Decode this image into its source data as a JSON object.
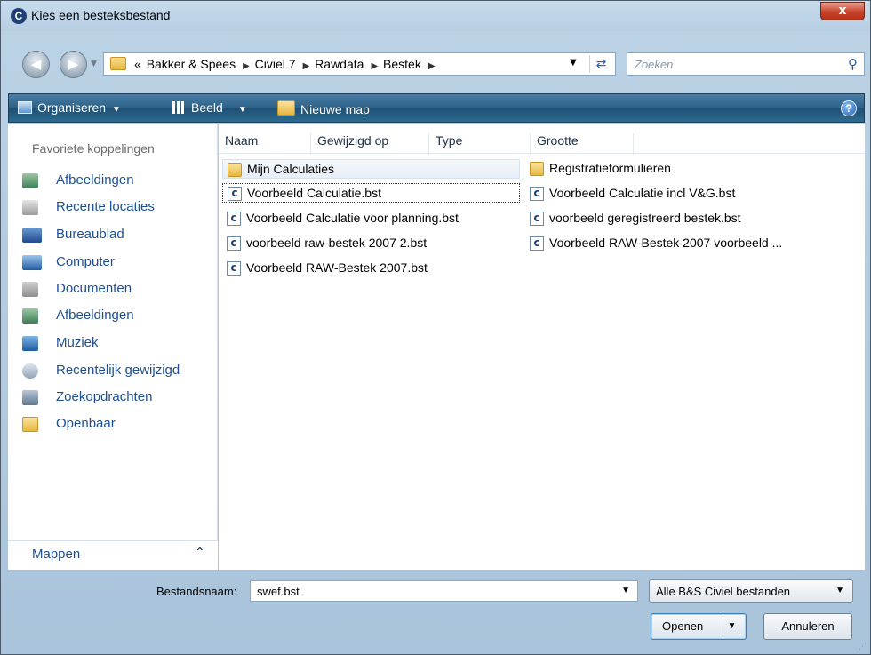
{
  "window": {
    "title": "Kies een besteksbestand",
    "close_label": "x"
  },
  "address_bar": {
    "overflow": "«",
    "crumbs": [
      "Bakker & Spees",
      "Civiel 7",
      "Rawdata",
      "Bestek"
    ]
  },
  "search": {
    "placeholder": "Zoeken"
  },
  "toolbar": {
    "organize_label": "Organiseren",
    "view_label": "Beeld",
    "new_folder_label": "Nieuwe map",
    "help_label": "?"
  },
  "nav_pane": {
    "heading": "Favoriete koppelingen",
    "items": [
      {
        "label": "Afbeeldingen",
        "icon": "pictures-icon"
      },
      {
        "label": "Recente locaties",
        "icon": "recent-places-icon"
      },
      {
        "label": "Bureaublad",
        "icon": "desktop-icon"
      },
      {
        "label": "Computer",
        "icon": "computer-icon"
      },
      {
        "label": "Documenten",
        "icon": "documents-icon"
      },
      {
        "label": "Afbeeldingen",
        "icon": "pictures-icon"
      },
      {
        "label": "Muziek",
        "icon": "music-icon"
      },
      {
        "label": "Recentelijk gewijzigd",
        "icon": "recently-changed-icon"
      },
      {
        "label": "Zoekopdrachten",
        "icon": "searches-icon"
      },
      {
        "label": "Openbaar",
        "icon": "folder-icon"
      }
    ],
    "folders_label": "Mappen"
  },
  "file_list": {
    "columns": [
      "Naam",
      "Gewijzigd op",
      "Type",
      "Grootte"
    ],
    "left_column": [
      {
        "name": "Mijn Calculaties",
        "kind": "folder"
      },
      {
        "name": "Voorbeeld Calculatie.bst",
        "kind": "bst"
      },
      {
        "name": "Voorbeeld Calculatie voor planning.bst",
        "kind": "bst"
      },
      {
        "name": "voorbeeld raw-bestek 2007 2.bst",
        "kind": "bst"
      },
      {
        "name": "Voorbeeld RAW-Bestek 2007.bst",
        "kind": "bst"
      }
    ],
    "right_column": [
      {
        "name": "Registratieformulieren",
        "kind": "folder"
      },
      {
        "name": "Voorbeeld Calculatie incl V&G.bst",
        "kind": "bst"
      },
      {
        "name": "voorbeeld geregistreerd bestek.bst",
        "kind": "bst"
      },
      {
        "name": "Voorbeeld RAW-Bestek 2007 voorbeeld ...",
        "kind": "bst"
      }
    ]
  },
  "footer": {
    "filename_label": "Bestandsnaam:",
    "filename_value": "swef.bst",
    "filter_value": "Alle B&S Civiel bestanden",
    "open_label": "Openen",
    "cancel_label": "Annuleren"
  }
}
